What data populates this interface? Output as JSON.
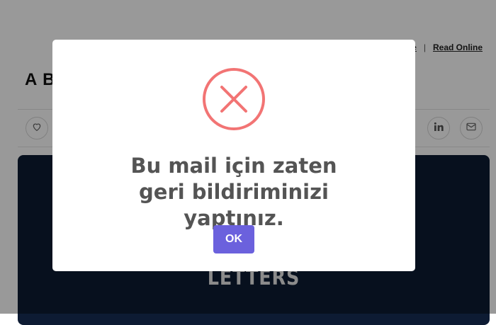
{
  "page": {
    "top_links": {
      "read_online": "Read Online",
      "separator": "|",
      "partial_link": "e"
    },
    "title_fragment": "A B",
    "hero_text": "LETTERS",
    "share_buttons": [
      {
        "icon": "heart-icon"
      },
      {
        "icon": "linkedin-icon"
      },
      {
        "icon": "mail-icon"
      }
    ]
  },
  "modal": {
    "icon": "error-x-icon",
    "message": "Bu mail için zaten geri bildiriminizi yaptınız.",
    "ok_label": "OK",
    "colors": {
      "icon": "#f27474",
      "button": "#6b61dd",
      "text": "#545454"
    }
  }
}
